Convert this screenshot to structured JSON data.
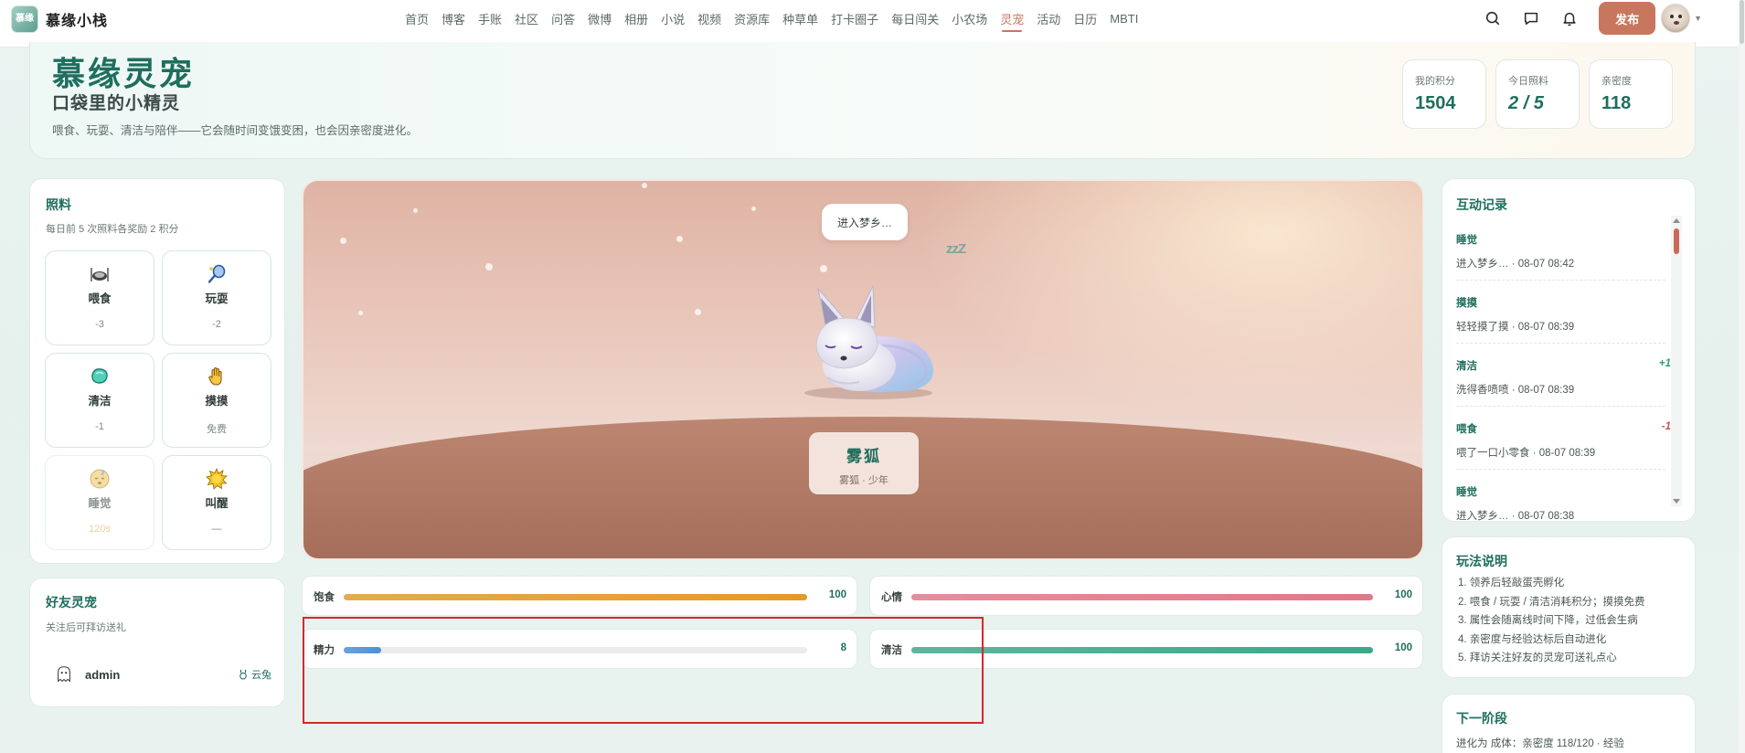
{
  "brand": {
    "name": "慕缘小栈",
    "logo_text": "慕缘"
  },
  "nav": {
    "items": [
      {
        "label": "首页"
      },
      {
        "label": "博客"
      },
      {
        "label": "手账"
      },
      {
        "label": "社区"
      },
      {
        "label": "问答"
      },
      {
        "label": "微博"
      },
      {
        "label": "相册"
      },
      {
        "label": "小说"
      },
      {
        "label": "视频"
      },
      {
        "label": "资源库"
      },
      {
        "label": "种草单"
      },
      {
        "label": "打卡圈子"
      },
      {
        "label": "每日闯关"
      },
      {
        "label": "小农场"
      },
      {
        "label": "灵宠",
        "active": true
      },
      {
        "label": "活动"
      },
      {
        "label": "日历"
      },
      {
        "label": "MBTI"
      }
    ],
    "publish_label": "发布",
    "icons": [
      "search-icon",
      "message-icon",
      "bell-icon"
    ]
  },
  "hero": {
    "title": "慕缘灵宠",
    "subtitle": "口袋里的小精灵",
    "description": "喂食、玩耍、清洁与陪伴——它会随时间变饿变困，也会因亲密度进化。",
    "stats": [
      {
        "label": "我的积分",
        "value": "1504"
      },
      {
        "label": "今日照料",
        "value": "2 / 5"
      },
      {
        "label": "亲密度",
        "value": "118"
      }
    ]
  },
  "care": {
    "title": "照料",
    "subtitle": "每日前 5 次照料各奖励 2 积分",
    "actions": [
      {
        "name": "喂食",
        "cost": "-3",
        "icon": "food-icon"
      },
      {
        "name": "玩耍",
        "cost": "-2",
        "icon": "racket-icon"
      },
      {
        "name": "清洁",
        "cost": "-1",
        "icon": "soap-icon"
      },
      {
        "name": "摸摸",
        "cost": "免费",
        "icon": "hand-icon"
      },
      {
        "name": "睡觉",
        "cost": "120s",
        "icon": "sleep-face-icon",
        "disabled": true
      },
      {
        "name": "叫醒",
        "cost": "—",
        "icon": "sun-icon"
      }
    ]
  },
  "friends": {
    "title": "好友灵宠",
    "subtitle": "关注后可拜访送礼",
    "list": [
      {
        "name": "admin",
        "pet": "云兔"
      }
    ]
  },
  "stage": {
    "speech": "进入梦乡…",
    "sleep_mark": "zzZ",
    "pet_name": "雾狐",
    "pet_meta": "雾狐 · 少年"
  },
  "bars": [
    {
      "label": "饱食",
      "value": 100,
      "color": "#e39a2c"
    },
    {
      "label": "心情",
      "value": 100,
      "color": "#e07889"
    },
    {
      "label": "精力",
      "value": 8,
      "color": "#4a90d9"
    },
    {
      "label": "清洁",
      "value": 100,
      "color": "#39a98a"
    }
  ],
  "log": {
    "title": "互动记录",
    "items": [
      {
        "action": "睡觉",
        "detail": "进入梦乡… · 08-07 08:42",
        "delta": ""
      },
      {
        "action": "摸摸",
        "detail": "轻轻摸了摸 · 08-07 08:39",
        "delta": ""
      },
      {
        "action": "清洁",
        "detail": "洗得香喷喷 · 08-07 08:39",
        "delta": "+1"
      },
      {
        "action": "喂食",
        "detail": "喂了一口小零食 · 08-07 08:39",
        "delta": "-1"
      },
      {
        "action": "睡觉",
        "detail": "进入梦乡… · 08-07 08:38",
        "delta": ""
      }
    ]
  },
  "rules": {
    "title": "玩法说明",
    "items": [
      "1. 领养后轻敲蛋壳孵化",
      "2. 喂食 / 玩耍 / 清洁消耗积分；摸摸免费",
      "3. 属性会随离线时间下降，过低会生病",
      "4. 亲密度与经验达标后自动进化",
      "5. 拜访关注好友的灵宠可送礼点心"
    ]
  },
  "next_stage": {
    "title": "下一阶段",
    "text": "进化为 成体：亲密度 118/120 · 经验"
  },
  "colors": {
    "accent": "#1f6e5e",
    "publish": "#c8765e",
    "highlight": "#d9262c"
  }
}
